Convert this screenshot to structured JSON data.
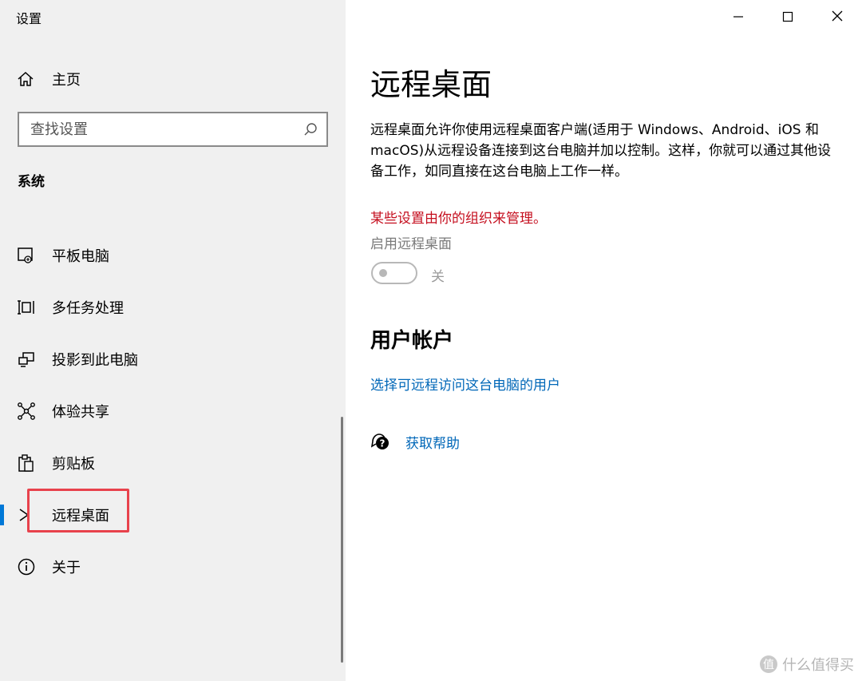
{
  "app": {
    "title": "设置"
  },
  "window_controls": {
    "minimize_icon": "minimize-icon",
    "maximize_icon": "maximize-icon",
    "close_icon": "close-icon"
  },
  "sidebar": {
    "home_label": "主页",
    "search": {
      "placeholder": "查找设置",
      "value": ""
    },
    "section_title": "系统",
    "items": [
      {
        "label": "平板电脑",
        "icon": "tablet-icon",
        "active": false
      },
      {
        "label": "多任务处理",
        "icon": "multitasking-icon",
        "active": false
      },
      {
        "label": "投影到此电脑",
        "icon": "project-icon",
        "active": false
      },
      {
        "label": "体验共享",
        "icon": "share-icon",
        "active": false
      },
      {
        "label": "剪贴板",
        "icon": "clipboard-icon",
        "active": false
      },
      {
        "label": "远程桌面",
        "icon": "remote-desktop-icon",
        "active": true
      },
      {
        "label": "关于",
        "icon": "info-icon",
        "active": false
      }
    ]
  },
  "main": {
    "title": "远程桌面",
    "description": "远程桌面允许你使用远程桌面客户端(适用于 Windows、Android、iOS 和 macOS)从远程设备连接到这台电脑并加以控制。这样，你就可以通过其他设备工作，如同直接在这台电脑上工作一样。",
    "managed_notice": "某些设置由你的组织来管理。",
    "toggle": {
      "label": "启用远程桌面",
      "state_text": "关",
      "on": false
    },
    "user_accounts": {
      "heading": "用户帐户",
      "link": "选择可远程访问这台电脑的用户"
    },
    "help": {
      "label": "获取帮助"
    }
  },
  "watermark": {
    "text": "什么值得买",
    "icon_text": "值"
  },
  "colors": {
    "accent": "#0078d7",
    "link": "#0067b8",
    "warning": "#c50f1f",
    "highlight_box": "#e8424c"
  }
}
